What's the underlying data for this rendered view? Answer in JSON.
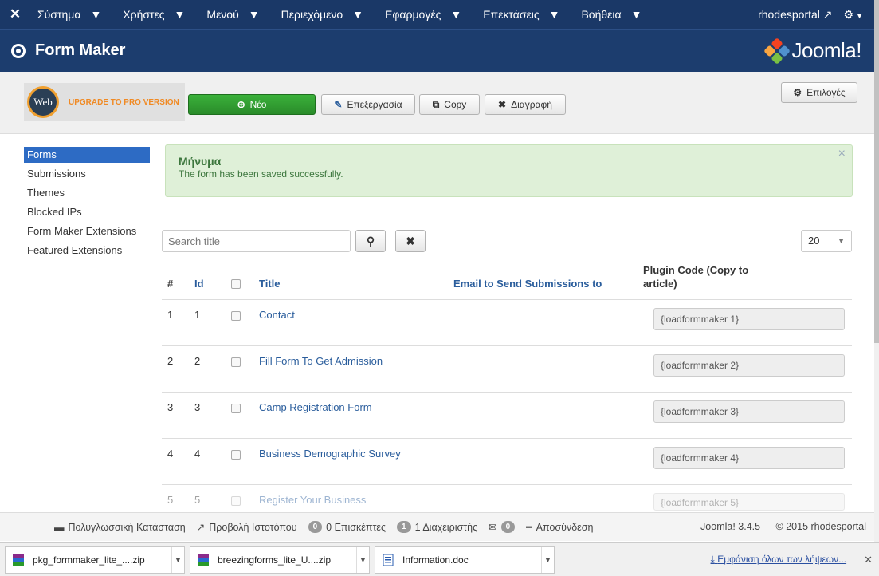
{
  "topnav": {
    "menus": [
      "Σύστημα",
      "Χρήστες",
      "Μενού",
      "Περιεχόμενο",
      "Εφαρμογές",
      "Επεκτάσεις",
      "Βοήθεια"
    ],
    "site_link": "rhodesportal"
  },
  "header": {
    "title": "Form Maker",
    "brand": "Joomla!"
  },
  "toolbar": {
    "upgrade_logo": "Web",
    "upgrade_text": "UPGRADE TO PRO VERSION",
    "new_label": "Νέο",
    "edit_label": "Επεξεργασία",
    "copy_label": "Copy",
    "delete_label": "Διαγραφή",
    "options_label": "Επιλογές"
  },
  "sidebar": {
    "items": [
      {
        "label": "Forms",
        "active": true
      },
      {
        "label": "Submissions"
      },
      {
        "label": "Themes"
      },
      {
        "label": "Blocked IPs"
      },
      {
        "label": "Form Maker Extensions"
      },
      {
        "label": "Featured Extensions"
      }
    ]
  },
  "alert": {
    "heading": "Μήνυμα",
    "message": "The form has been saved successfully."
  },
  "search": {
    "placeholder": "Search title",
    "limit": "20"
  },
  "table": {
    "headers": {
      "num": "#",
      "id": "Id",
      "title": "Title",
      "email": "Email to Send Submissions to",
      "plugin": "Plugin Code (Copy to article)"
    },
    "rows": [
      {
        "num": "1",
        "id": "1",
        "title": "Contact",
        "code": "{loadformmaker 1}"
      },
      {
        "num": "2",
        "id": "2",
        "title": "Fill Form To Get Admission",
        "code": "{loadformmaker 2}"
      },
      {
        "num": "3",
        "id": "3",
        "title": "Camp Registration Form",
        "code": "{loadformmaker 3}"
      },
      {
        "num": "4",
        "id": "4",
        "title": "Business Demographic Survey",
        "code": "{loadformmaker 4}"
      },
      {
        "num": "5",
        "id": "5",
        "title": "Register Your Business",
        "code": "{loadformmaker 5}"
      }
    ]
  },
  "status": {
    "multilang": "Πολυγλωσσική Κατάσταση",
    "view_site": "Προβολή Ιστοτόπου",
    "visitors_count": "0",
    "visitors_label": "0 Επισκέπτες",
    "admins_count": "1",
    "admins_label": "1 Διαχειριστής",
    "messages_count": "0",
    "logout": "Αποσύνδεση",
    "copyright": "Joomla! 3.4.5 — © 2015 rhodesportal"
  },
  "downloads": {
    "files": [
      {
        "name": "pkg_formmaker_lite_....zip",
        "type": "archive"
      },
      {
        "name": "breezingforms_lite_U....zip",
        "type": "archive"
      },
      {
        "name": "Information.doc",
        "type": "doc"
      }
    ],
    "show_all": "Εμφάνιση όλων των λήψεων..."
  },
  "colors": {
    "nav": "#1a3867",
    "header": "#1c3d6e",
    "accent": "#2d6bc4",
    "success_bg": "#dff0d8",
    "new_btn": "#2f9e2f"
  }
}
